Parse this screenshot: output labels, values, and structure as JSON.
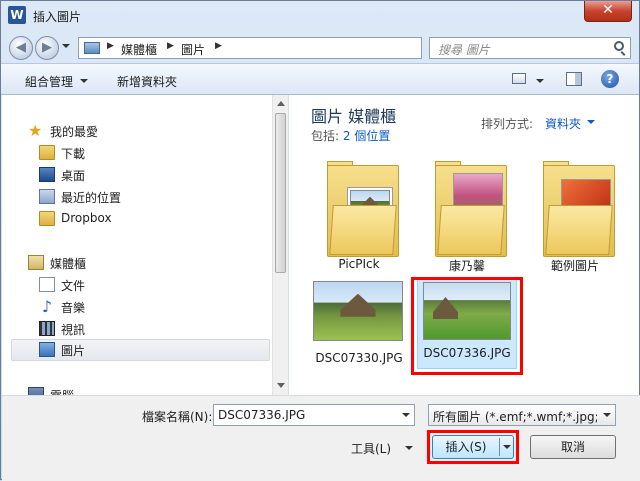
{
  "window": {
    "title": "插入圖片",
    "app_icon": "W",
    "close_glyph": "✕"
  },
  "navigation": {
    "back_glyph": "◀",
    "forward_glyph": "▶",
    "breadcrumbs": [
      "媒體櫃",
      "圖片"
    ],
    "search_placeholder": "搜尋 圖片"
  },
  "toolbar": {
    "organize": "組合管理",
    "new_folder": "新增資料夾",
    "help_glyph": "?"
  },
  "sidebar": {
    "items": [
      {
        "label": "我的最愛"
      },
      {
        "label": "下載"
      },
      {
        "label": "桌面"
      },
      {
        "label": "最近的位置"
      },
      {
        "label": "Dropbox"
      },
      {
        "label": "媒體櫃"
      },
      {
        "label": "文件"
      },
      {
        "label": "音樂"
      },
      {
        "label": "視訊"
      },
      {
        "label": "圖片"
      },
      {
        "label": "電腦"
      }
    ]
  },
  "content": {
    "library_title": "圖片 媒體櫃",
    "includes_label": "包括:",
    "includes_link": "2 個位置",
    "sort_label": "排列方式:",
    "sort_value": "資料夾",
    "items": [
      {
        "label": "PicPIck"
      },
      {
        "label": "康乃馨"
      },
      {
        "label": "範例圖片"
      },
      {
        "label": "DSC07330.JPG"
      },
      {
        "label": "DSC07336.JPG"
      }
    ]
  },
  "footer": {
    "filename_label": "檔案名稱(N):",
    "filename_value": "DSC07336.JPG",
    "filter_value": "所有圖片 (*.emf;*.wmf;*.jpg;*.j",
    "tools_label": "工具(L)",
    "insert_label": "插入(S)",
    "cancel_label": "取消"
  },
  "colors": {
    "accent": "#0b58c7",
    "highlight": "#ff0000",
    "selection": "#cce8ff"
  }
}
